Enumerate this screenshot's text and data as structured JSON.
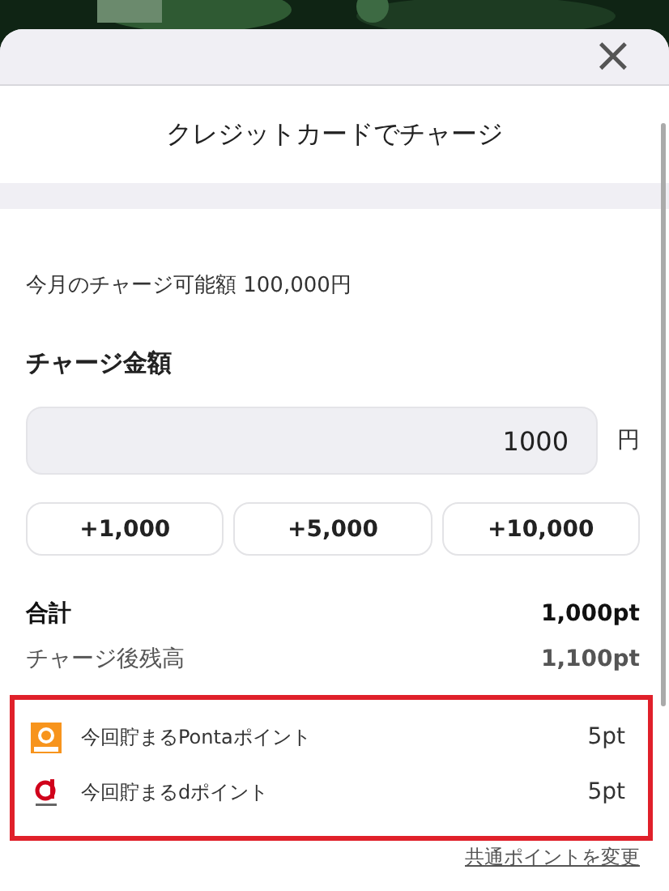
{
  "sheet": {
    "close": "×",
    "title": "クレジットカードでチャージ"
  },
  "limit": "今月のチャージ可能額 100,000円",
  "amount": {
    "label": "チャージ金額",
    "value": "1000",
    "unit": "円"
  },
  "quick_buttons": [
    "+1,000",
    "+5,000",
    "+10,000"
  ],
  "summary": [
    {
      "label": "合計",
      "value": "1,000pt",
      "kind": "total"
    },
    {
      "label": "チャージ後残高",
      "value": "1,100pt",
      "kind": "balance"
    }
  ],
  "points": [
    {
      "kind": "ponta",
      "label": "今回貯まるPontaポイント",
      "value": "5pt"
    },
    {
      "kind": "d",
      "label": "今回貯まるdポイント",
      "value": "5pt"
    }
  ],
  "change_link": "共通ポイントを変更"
}
